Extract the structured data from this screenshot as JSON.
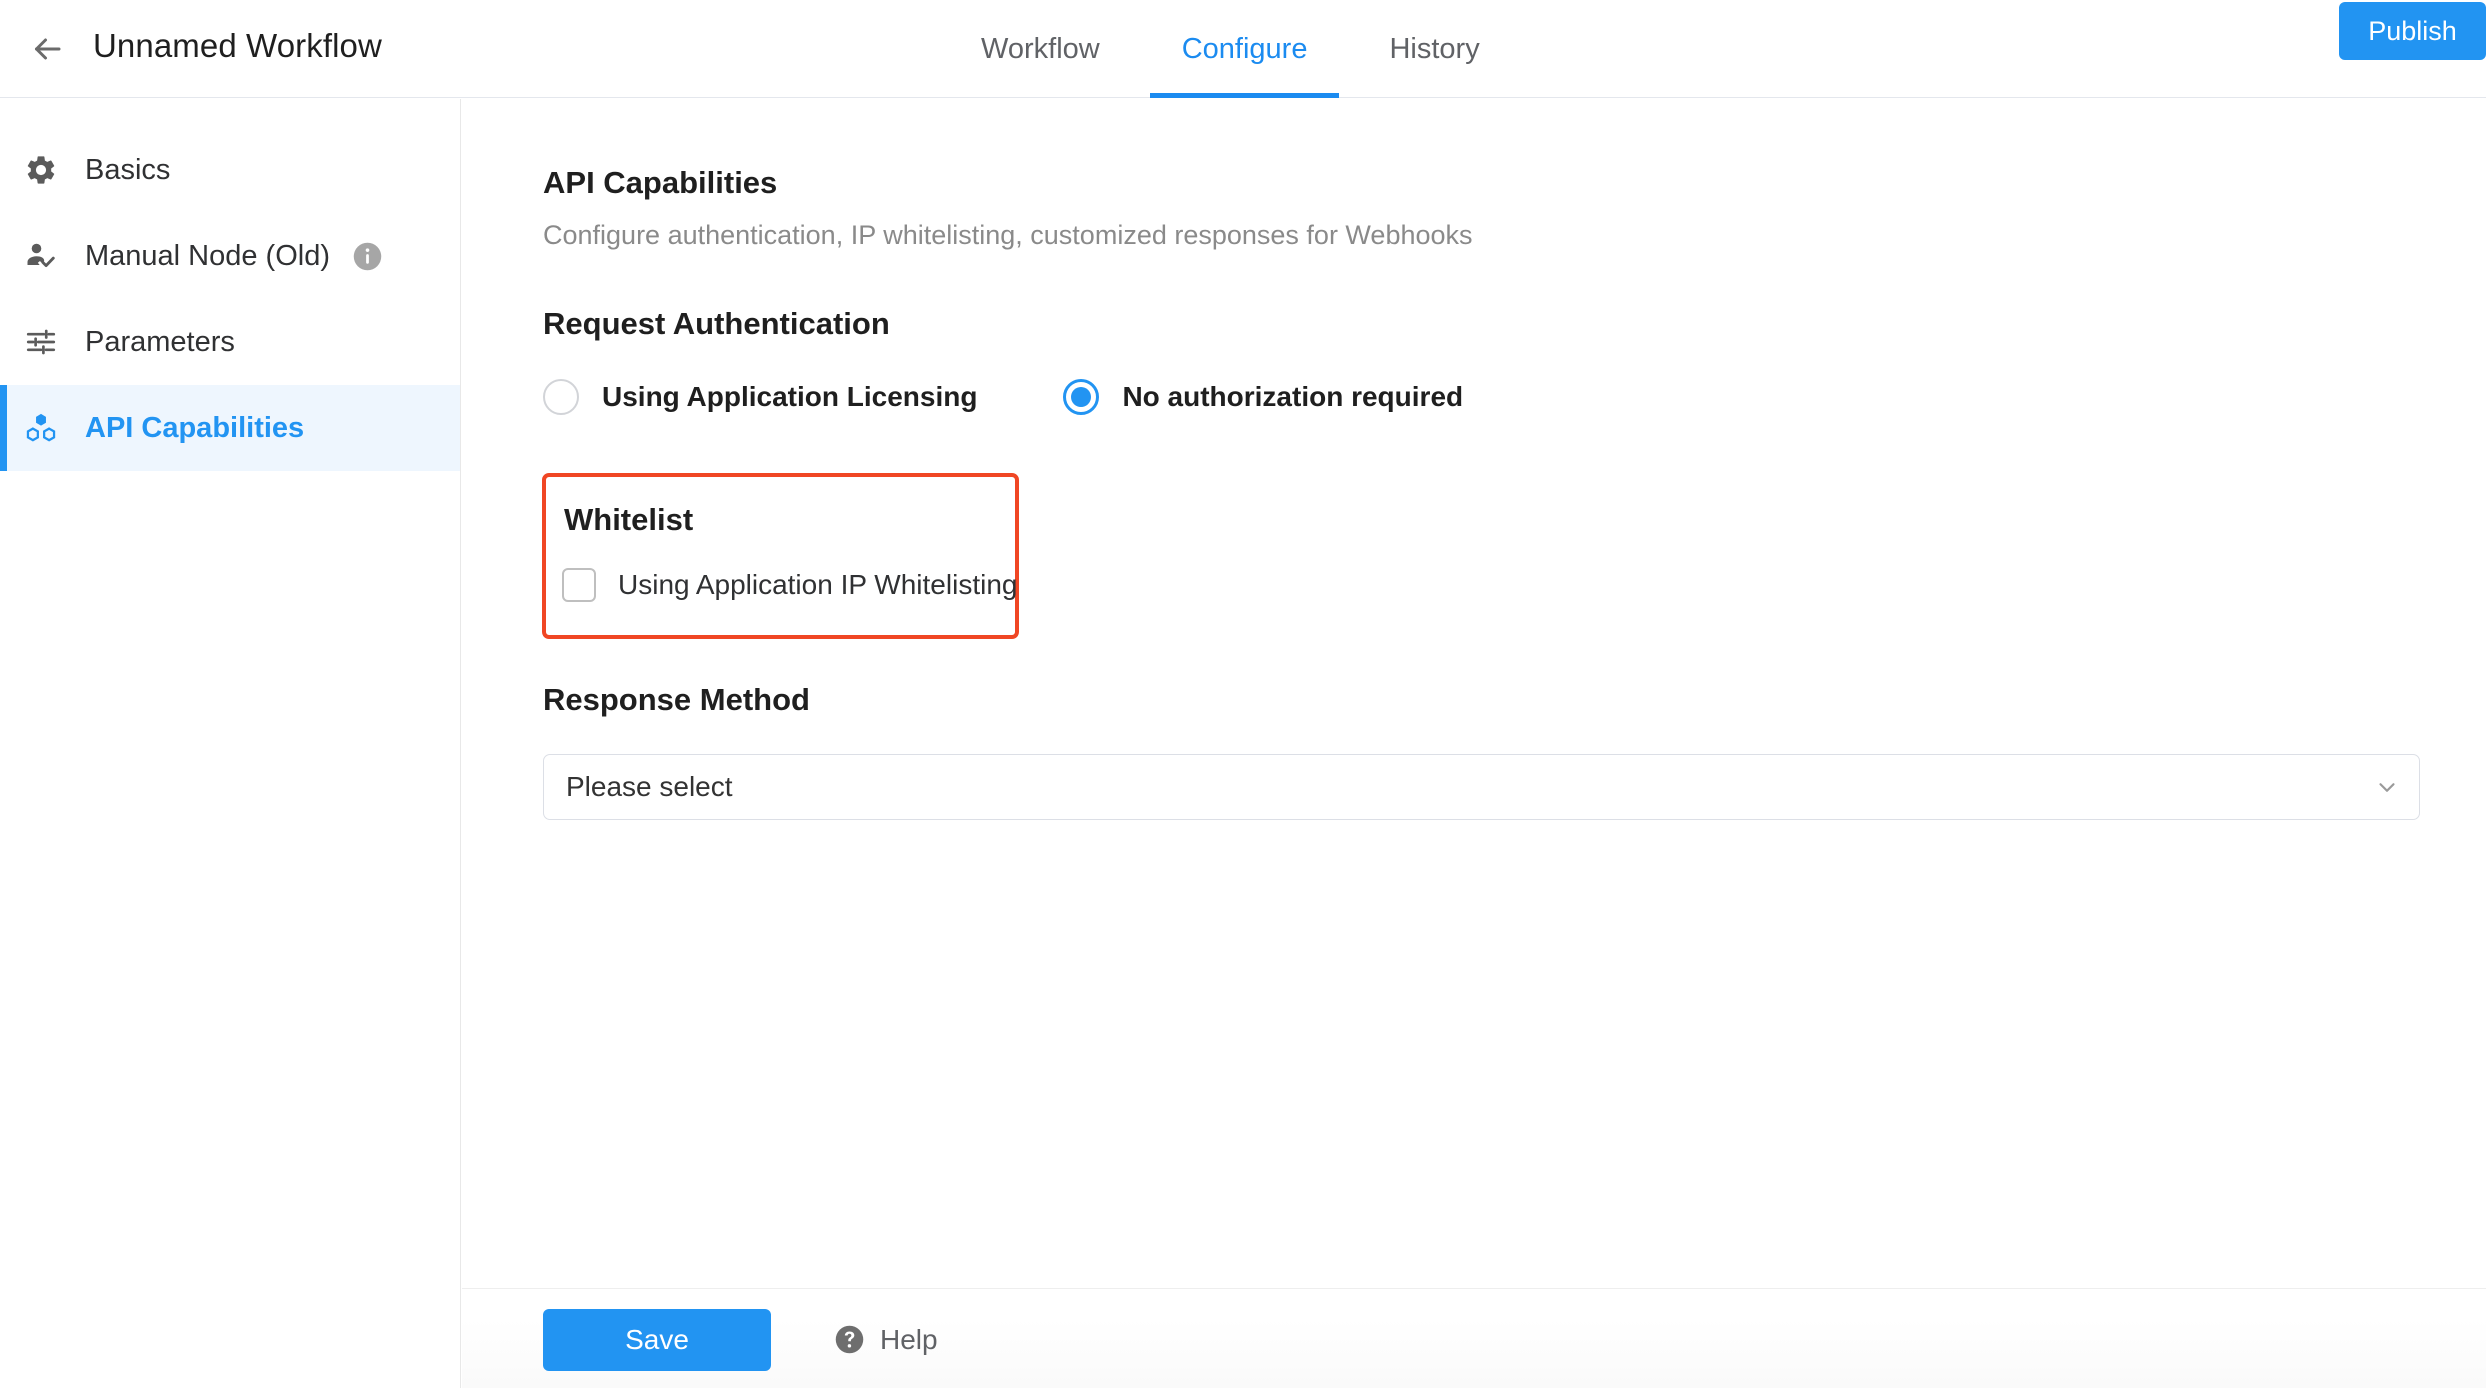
{
  "header": {
    "back_icon": "arrow-left-icon",
    "workflow_title": "Unnamed Workflow",
    "tabs": [
      {
        "label": "Workflow",
        "active": false
      },
      {
        "label": "Configure",
        "active": true
      },
      {
        "label": "History",
        "active": false
      }
    ],
    "publish_label": "Publish"
  },
  "sidebar": {
    "items": [
      {
        "label": "Basics",
        "icon": "gear-icon",
        "active": false,
        "has_info": false
      },
      {
        "label": "Manual Node (Old)",
        "icon": "person-check-icon",
        "active": false,
        "has_info": true
      },
      {
        "label": "Parameters",
        "icon": "sliders-icon",
        "active": false,
        "has_info": false
      },
      {
        "label": "API Capabilities",
        "icon": "molecule-icon",
        "active": true,
        "has_info": false
      }
    ]
  },
  "main": {
    "page_title": "API Capabilities",
    "page_subtitle": "Configure authentication, IP whitelisting, customized responses for Webhooks",
    "auth_section": {
      "title": "Request Authentication",
      "options": [
        {
          "label": "Using Application Licensing",
          "checked": false
        },
        {
          "label": "No authorization required",
          "checked": true
        }
      ]
    },
    "whitelist_section": {
      "title": "Whitelist",
      "checkbox_label": "Using Application IP Whitelisting",
      "checked": false,
      "highlight_color": "#f04624"
    },
    "response_section": {
      "title": "Response Method",
      "select_value": "Please select",
      "select_placeholder": "Please select",
      "caret_icon": "chevron-down-icon"
    }
  },
  "footer": {
    "save_label": "Save",
    "help_label": "Help",
    "help_icon": "question-circle-icon"
  },
  "colors": {
    "accent": "#2294f2",
    "highlight": "#f04624",
    "muted_text": "#8a8a8a",
    "sidebar_active_bg": "#eef6fe"
  }
}
